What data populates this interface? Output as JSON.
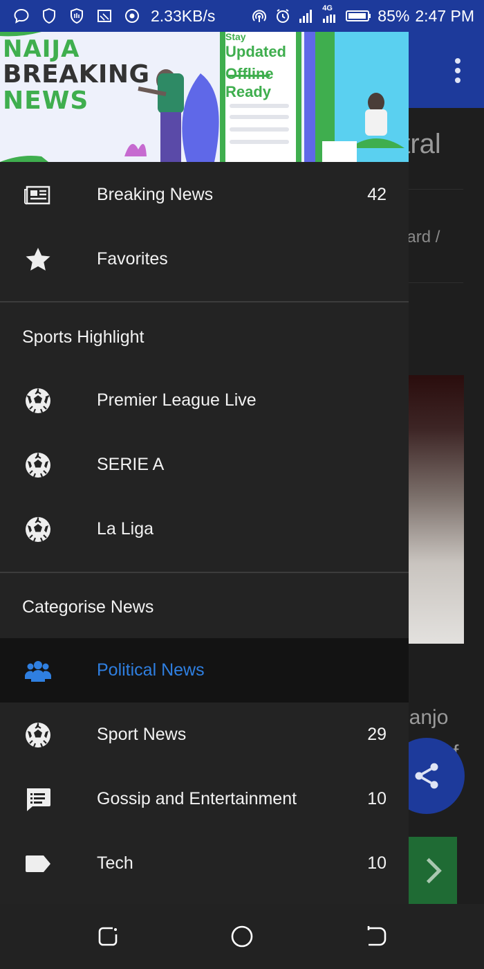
{
  "status_bar": {
    "speed": "2.33KB/s",
    "network": "4G",
    "battery": "85%",
    "time": "2:47 PM",
    "left_icons": [
      "chat-bubble-icon",
      "shield-icon",
      "shield-badge-icon",
      "cast-icon",
      "radio-target-icon"
    ],
    "right_icons": [
      "hotspot-icon",
      "alarm-icon",
      "signal-icon",
      "signal-4g-icon",
      "battery-icon"
    ]
  },
  "background": {
    "title_fragment": "utral",
    "author_fragment": "hard /",
    "text_fragment": "asanjo",
    "text_fragment2": "f"
  },
  "drawer": {
    "header": {
      "logo_line1": "NAIJA",
      "logo_line2": "BREAKING",
      "logo_line3": "NEWS",
      "promo_stay": "Stay",
      "promo_line1": "Updated",
      "promo_line2": "Offline",
      "promo_line3": "Ready"
    },
    "top_items": [
      {
        "label": "Breaking News",
        "count": "42",
        "icon": "newspaper-icon"
      },
      {
        "label": "Favorites",
        "count": "",
        "icon": "star-icon"
      }
    ],
    "sports_title": "Sports Highlight",
    "sports_items": [
      {
        "label": "Premier League Live",
        "icon": "soccer-ball-icon"
      },
      {
        "label": "SERIE A",
        "icon": "soccer-ball-icon"
      },
      {
        "label": "La Liga",
        "icon": "soccer-ball-icon"
      }
    ],
    "categories_title": "Categorise News",
    "category_items": [
      {
        "label": "Political News",
        "count": "",
        "icon": "people-icon"
      },
      {
        "label": "Sport News",
        "count": "29",
        "icon": "soccer-ball-icon"
      },
      {
        "label": "Gossip and Entertainment",
        "count": "10",
        "icon": "chat-list-icon"
      },
      {
        "label": "Tech",
        "count": "10",
        "icon": "label-tag-icon"
      }
    ]
  },
  "colors": {
    "primary": "#1d3a9b",
    "drawer_bg": "#232323",
    "active_bg": "#131313",
    "accent_active": "#2f7fe0",
    "brand_green": "#3fae4e"
  }
}
